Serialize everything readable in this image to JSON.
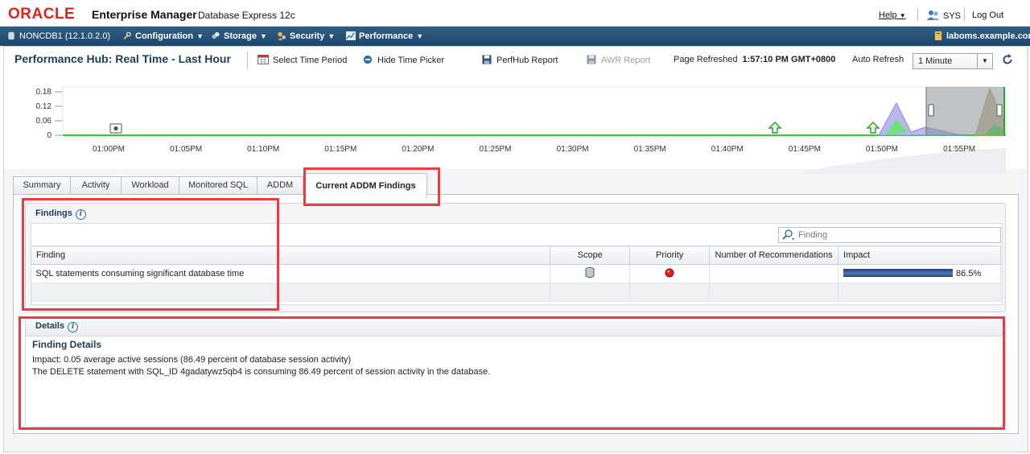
{
  "header": {
    "brand": "ORACLE",
    "product": "Enterprise Manager",
    "product_sub": "Database Express 12c",
    "help": "Help",
    "user": "SYS",
    "logout": "Log Out"
  },
  "nav": {
    "db": "NONCDB1 (12.1.0.2.0)",
    "menus": [
      "Configuration",
      "Storage",
      "Security",
      "Performance"
    ],
    "host": "laboms.example.com"
  },
  "toolbar": {
    "title": "Performance Hub: Real Time - Last Hour",
    "select_time": "Select Time Period",
    "hide_picker": "Hide Time Picker",
    "perfhub_report": "PerfHub Report",
    "awr_report": "AWR Report",
    "page_refreshed_label": "Page Refreshed",
    "page_refreshed_value": "1:57:10 PM GMT+0800",
    "auto_refresh_label": "Auto Refresh",
    "auto_refresh_value": "1 Minute"
  },
  "chart_data": {
    "type": "area",
    "y_ticks": [
      "0.18",
      "0.12",
      "0.06",
      "0"
    ],
    "x_ticks": [
      "01:00PM",
      "01:05PM",
      "01:10PM",
      "01:15PM",
      "01:20PM",
      "01:25PM",
      "01:30PM",
      "01:35PM",
      "01:40PM",
      "01:45PM",
      "01:50PM",
      "01:55PM"
    ],
    "ylim": [
      0,
      0.18
    ]
  },
  "tabs": [
    "Summary",
    "Activity",
    "Workload",
    "Monitored SQL",
    "ADDM",
    "Current ADDM Findings"
  ],
  "findings": {
    "title": "Findings",
    "search_placeholder": "Finding",
    "columns": [
      "Finding",
      "Scope",
      "Priority",
      "Number of Recommendations",
      "Impact"
    ],
    "rows": [
      {
        "finding": "SQL statements consuming significant database time",
        "recommendations": "",
        "impact": "86.5%",
        "impact_fraction": 0.865
      }
    ]
  },
  "details": {
    "title": "Details",
    "subtitle": "Finding Details",
    "line1": "Impact: 0.05 average active sessions (86.49 percent of database session activity)",
    "line2": "The DELETE statement with SQL_ID 4gadatywz5qb4 is consuming 86.49 percent of session activity in the database."
  }
}
